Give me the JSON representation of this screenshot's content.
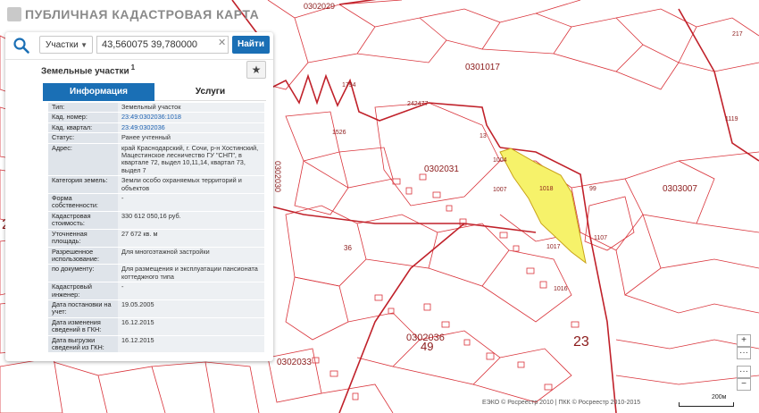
{
  "app": {
    "title": "ПУБЛИЧНАЯ КАДАСТРОВАЯ КАРТА"
  },
  "search": {
    "type_label": "Участки",
    "query": "43,560075 39,780000",
    "button_label": "Найти"
  },
  "panel": {
    "title": "Земельные участки",
    "count": "1",
    "tabs": [
      {
        "label": "Информация"
      },
      {
        "label": "Услуги"
      }
    ],
    "rows": [
      {
        "key": "Тип:",
        "value": "Земельный участок"
      },
      {
        "key": "Кад. номер:",
        "value": "23:49:0302036:1018"
      },
      {
        "key": "Кад. квартал:",
        "value": "23:49:0302036"
      },
      {
        "key": "Статус:",
        "value": "Ранее учтенный"
      },
      {
        "key": "Адрес:",
        "value": "край Краснодарский, г. Сочи, р-н Хостинский, Мацестинское лесничество ГУ \"СНП\", в квартале 72, выдел 10,11,14, квартал 73, выдел 7"
      },
      {
        "key": "Категория земель:",
        "value": "Земли особо охраняемых территорий и объектов"
      },
      {
        "key": "Форма собственности:",
        "value": "-"
      },
      {
        "key": "Кадастровая стоимость:",
        "value": "330 612 050,16 руб."
      },
      {
        "key": "Уточненная площадь:",
        "value": "27 672 кв. м"
      },
      {
        "key": "Разрешенное использование:",
        "value": "Для многоэтажной застройки"
      },
      {
        "key": "по документу:",
        "value": "Для размещения и эксплуатации пансионата коттеджного типа"
      },
      {
        "key": "Кадастровый инженер:",
        "value": "-"
      },
      {
        "key": "Дата постановки на учет:",
        "value": "19.05.2005"
      },
      {
        "key": "Дата изменения сведений в ГКН:",
        "value": "16.12.2015"
      },
      {
        "key": "Дата выгрузки сведений из ГКН:",
        "value": "16.12.2015"
      }
    ]
  },
  "map": {
    "labels": [
      {
        "text": "0302029"
      },
      {
        "text": "0302030"
      },
      {
        "text": "0302031"
      },
      {
        "text": "0302036"
      },
      {
        "text": "0302033"
      },
      {
        "text": "0301017"
      },
      {
        "text": "0303007"
      },
      {
        "text": "1004"
      },
      {
        "text": "1007"
      },
      {
        "text": "1018"
      },
      {
        "text": "1017"
      },
      {
        "text": "1016"
      },
      {
        "text": "1107"
      },
      {
        "text": "99"
      },
      {
        "text": "1526"
      },
      {
        "text": "1794"
      },
      {
        "text": "242477"
      },
      {
        "text": "36"
      },
      {
        "text": "49"
      },
      {
        "text": "23"
      },
      {
        "text": "23"
      },
      {
        "text": "13"
      },
      {
        "text": "217"
      },
      {
        "text": "1119"
      }
    ],
    "attribution": "ЕЭКО © Росреестр 2010 | ПКК © Росреестр 2010-2015",
    "scale": "200м",
    "colors": {
      "boundary": "#d9333a",
      "selected_fill": "#f6f26a",
      "background": "#ffffff"
    }
  },
  "controls": {
    "zoom_in": "+",
    "zoom_out": "−",
    "more": "···"
  }
}
